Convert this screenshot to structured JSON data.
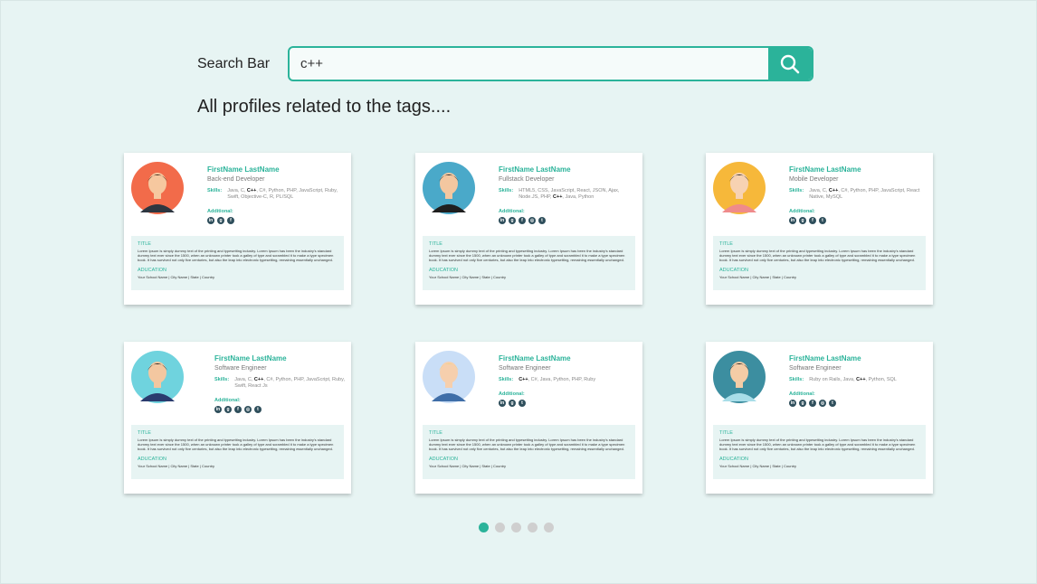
{
  "search": {
    "label": "Search Bar",
    "value": "c++"
  },
  "results_heading": "All profiles related to the  tags....",
  "colors": {
    "accent": "#2bb39a",
    "background": "#e7f4f3"
  },
  "cards": [
    {
      "name": "FirstName LastName",
      "role": "Back-end Developer",
      "skills_label": "Skills:",
      "skills_before": "Java, C, ",
      "skills_match": "C++",
      "skills_after": ", C#, Python, PHP, JavaScript, Ruby, Swift, Objective-C, R, PL/SQL",
      "additional_label": "Additional:",
      "socials": [
        "linkedin-icon",
        "github-icon",
        "facebook-icon"
      ],
      "detail_title": "TITLE",
      "detail_desc": "Lorem Ipsum is simply dummy text of the printing and typesetting industry. Lorem Ipsum has been the industry's standard dummy text ever since the 1500, when an unknown printer took a galley of type and scrambled it to make a type specimen book. It has survived not only five centuries, but also the leap into electronic typesetting, remaining essentially unchanged.",
      "edu_label": "ADUCATION",
      "school": "Your School Name | City Name | State | Country",
      "avatar": "female-orange"
    },
    {
      "name": "FirstName LastName",
      "role": "Fullstack Developer",
      "skills_label": "Skills:",
      "skills_before": "HTML5, CSS, JavaScript, React, JSON, Ajax, Node.JS, PHP, ",
      "skills_match": "C++",
      "skills_after": ", Java, Python",
      "additional_label": "Additional:",
      "socials": [
        "linkedin-icon",
        "github-icon",
        "facebook-icon",
        "instagram-icon",
        "twitter-icon"
      ],
      "detail_title": "TITLE",
      "detail_desc": "Lorem Ipsum is simply dummy text of the printing and typesetting industry. Lorem Ipsum has been the industry's standard dummy text ever since the 1500, when an unknown printer took a galley of type and scrambled it to make a type specimen book. It has survived not only five centuries, but also the leap into electronic typesetting, remaining essentially unchanged.",
      "edu_label": "ADUCATION",
      "school": "Your School Name | City Name | State | Country",
      "avatar": "male-glasses-blue"
    },
    {
      "name": "FirstName LastName",
      "role": "Mobile Developer",
      "skills_label": "Skills:",
      "skills_before": "Java, C, ",
      "skills_match": "C++",
      "skills_after": ", C#, Python, PHP, JavaScript, React Native, MySQL",
      "additional_label": "Additional:",
      "socials": [
        "linkedin-icon",
        "github-icon",
        "facebook-icon",
        "twitter-icon"
      ],
      "detail_title": "TITLE",
      "detail_desc": "Lorem Ipsum is simply dummy text of the printing and typesetting industry. Lorem Ipsum has been the industry's standard dummy text ever since the 1500, when an unknown printer took a galley of type and scrambled it to make a type specimen book. It has survived not only five centuries, but also the leap into electronic typesetting, remaining essentially unchanged.",
      "edu_label": "ADUCATION",
      "school": "Your School Name | City Name | State | Country",
      "avatar": "female-glasses-yellow"
    },
    {
      "name": "FirstName LastName",
      "role": "Software Engineer",
      "skills_label": "Skills:",
      "skills_before": "Java, C, ",
      "skills_match": "C++",
      "skills_after": ", C#, Python, PHP, JavaScript, Ruby, Swift, React Js",
      "additional_label": "Additional:",
      "socials": [
        "linkedin-icon",
        "github-icon",
        "facebook-icon",
        "instagram-icon",
        "twitter-icon"
      ],
      "detail_title": "TITLE",
      "detail_desc": "Lorem Ipsum is simply dummy text of the printing and typesetting industry. Lorem Ipsum has been the industry's standard dummy text ever since the 1500, when an unknown printer took a galley of type and scrambled it to make a type specimen book. It has survived not only five centuries, but also the leap into electronic typesetting, remaining essentially unchanged.",
      "edu_label": "ADUCATION",
      "school": "Your School Name | City Name | State | Country",
      "avatar": "male-suit-cyan"
    },
    {
      "name": "FirstName LastName",
      "role": "Software Engineer",
      "skills_label": "Skills:",
      "skills_before": "",
      "skills_match": "C++",
      "skills_after": ", C#, Java, Python, PHP, Ruby",
      "additional_label": "Additional:",
      "socials": [
        "linkedin-icon",
        "github-icon",
        "twitter-icon"
      ],
      "detail_title": "TITLE",
      "detail_desc": "Lorem Ipsum is simply dummy text of the printing and typesetting industry. Lorem Ipsum has been the industry's standard dummy text ever since the 1500, when an unknown printer took a galley of type and scrambled it to make a type specimen book. It has survived not only five centuries, but also the leap into electronic typesetting, remaining essentially unchanged.",
      "edu_label": "ADUCATION",
      "school": "Your School Name | City Name | State | Country",
      "avatar": "female-blonde-lightblue"
    },
    {
      "name": "FirstName LastName",
      "role": "Software Engineer",
      "skills_label": "Skills:",
      "skills_before": "Ruby on Rails, Java, ",
      "skills_match": "C++",
      "skills_after": ", Python, SQL",
      "additional_label": "Additional:",
      "socials": [
        "linkedin-icon",
        "github-icon",
        "facebook-icon",
        "instagram-icon",
        "twitter-icon"
      ],
      "detail_title": "TITLE",
      "detail_desc": "Lorem Ipsum is simply dummy text of the printing and typesetting industry. Lorem Ipsum has been the industry's standard dummy text ever since the 1500, when an unknown printer took a galley of type and scrambled it to make a type specimen book. It has survived not only five centuries, but also the leap into electronic typesetting, remaining essentially unchanged.",
      "edu_label": "ADUCATION",
      "school": "Your School Name | City Name | State | Country",
      "avatar": "female-dark-teal"
    }
  ],
  "pagination": {
    "pages": 5,
    "current": 1
  }
}
